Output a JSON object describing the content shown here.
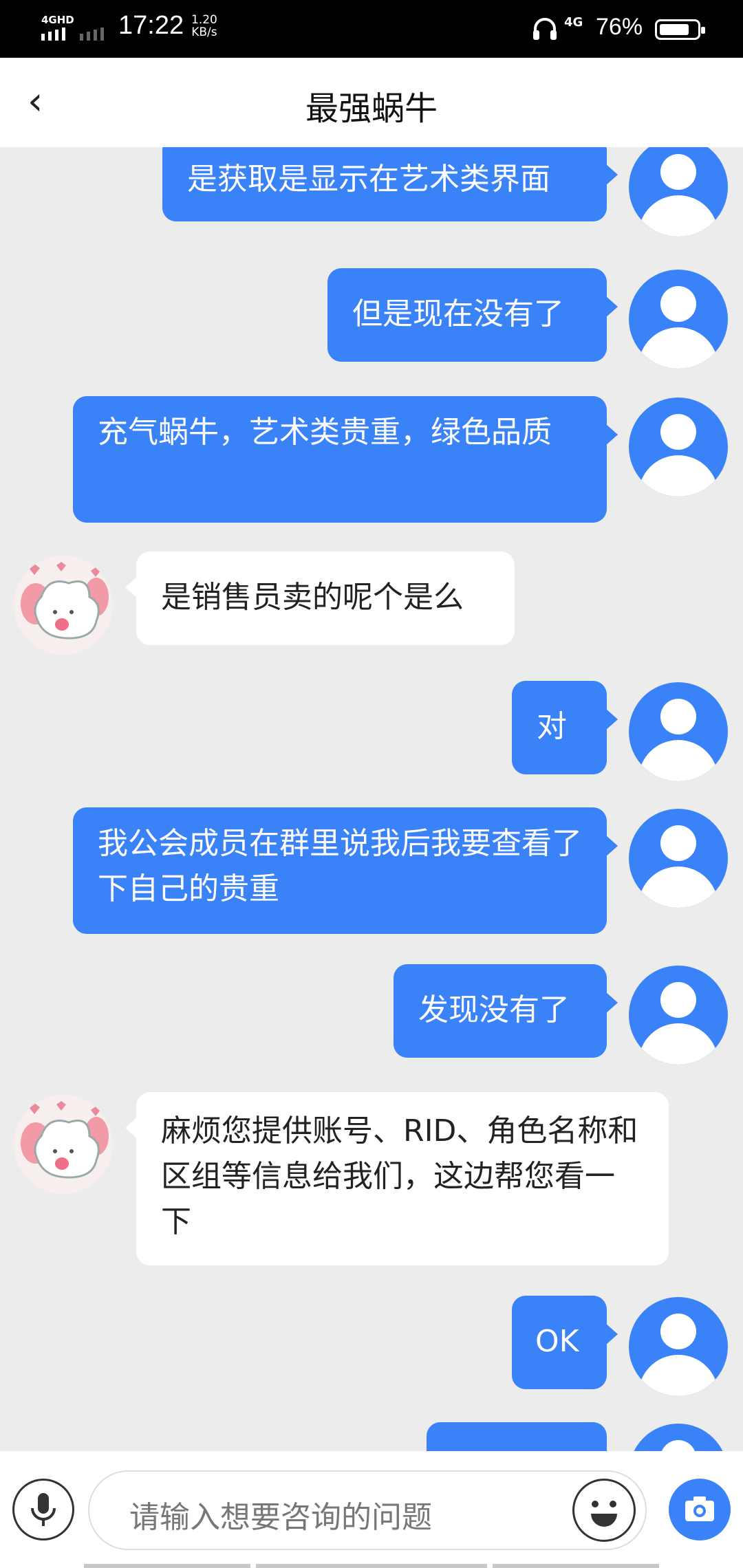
{
  "status_bar": {
    "network": "4GHD",
    "time": "17:22",
    "speed_value": "1.20",
    "speed_unit": "KB/s",
    "network2": "4G",
    "battery": "76%",
    "battery_level": 0.76
  },
  "header": {
    "back_icon": "‹",
    "title": "最强蜗牛"
  },
  "messages": [
    {
      "from": "me",
      "text": "是获取是显示在艺术类界面"
    },
    {
      "from": "me",
      "text": "但是现在没有了"
    },
    {
      "from": "me",
      "text": "充气蜗牛，艺术类贵重，绿色品质"
    },
    {
      "from": "them",
      "text": "是销售员卖的呢个是么"
    },
    {
      "from": "me",
      "text": "对"
    },
    {
      "from": "me",
      "text": "我公会成员在群里说我后我要查看了下自己的贵重"
    },
    {
      "from": "me",
      "text": "发现没有了"
    },
    {
      "from": "them",
      "text": "麻烦您提供账号、RID、角色名称和区组等信息给我们，这边帮您看一下"
    },
    {
      "from": "me",
      "text": "OK"
    }
  ],
  "input": {
    "placeholder": "请输入想要咨询的问题"
  },
  "colors": {
    "accent": "#3a82f7",
    "background": "#ececec"
  },
  "icons": [
    "back-arrow-icon",
    "mic-icon",
    "emoji-icon",
    "camera-icon",
    "user-avatar-icon"
  ]
}
